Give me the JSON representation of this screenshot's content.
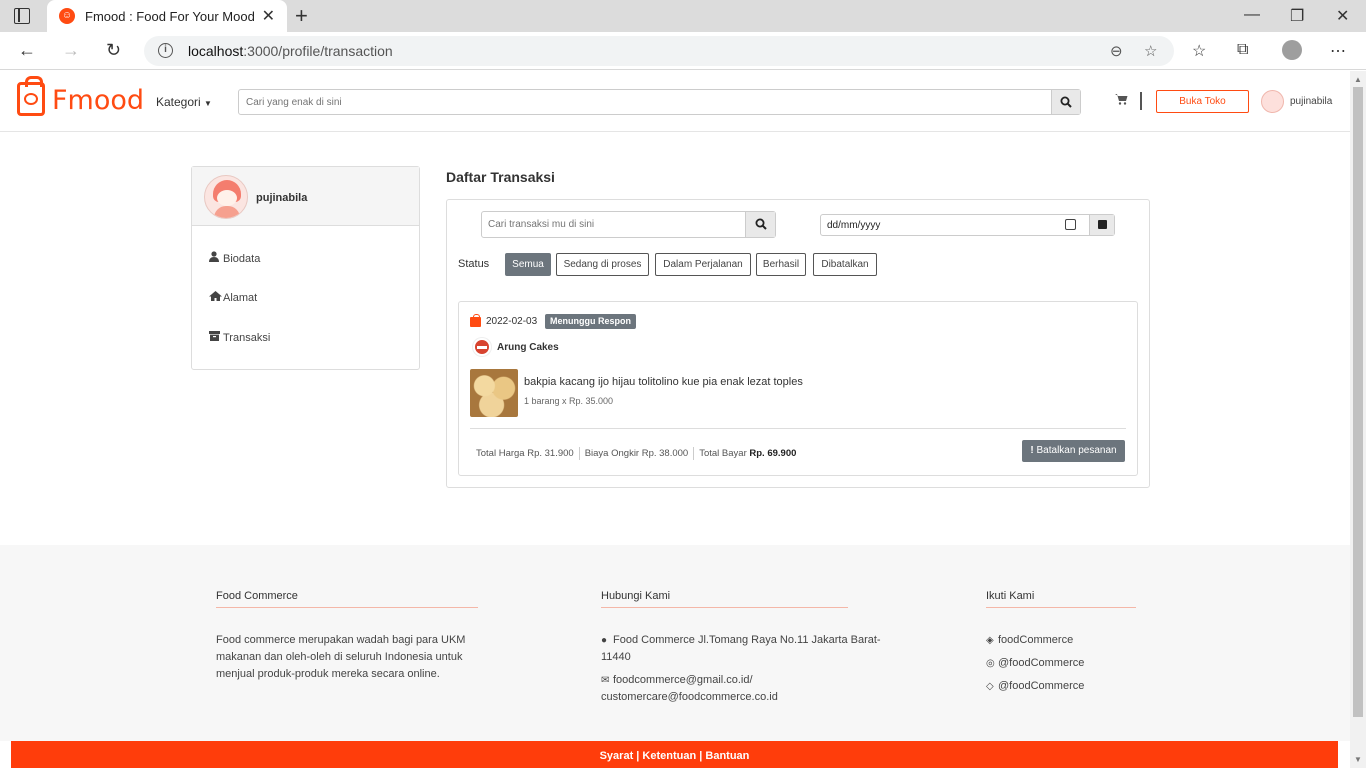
{
  "browser": {
    "tab_title": "Fmood : Food For Your Mood",
    "url_host": "localhost",
    "url_path": ":3000/profile/transaction"
  },
  "header": {
    "logo_text": "Fmood",
    "kategori_label": "Kategori",
    "search_placeholder": "Cari yang enak di sini",
    "buka_toko_label": "Buka Toko",
    "username": "pujinabila"
  },
  "sidebar": {
    "username": "pujinabila",
    "items": [
      {
        "label": "Biodata",
        "icon": "user-icon"
      },
      {
        "label": "Alamat",
        "icon": "home-icon"
      },
      {
        "label": "Transaksi",
        "icon": "archive-icon"
      }
    ]
  },
  "transactions": {
    "title": "Daftar Transaksi",
    "search_placeholder": "Cari transaksi mu di sini",
    "date_value": "dd/mm/yyyy",
    "status_label": "Status",
    "status_filters": [
      "Semua",
      "Sedang di proses",
      "Dalam Perjalanan",
      "Berhasil",
      "Dibatalkan"
    ],
    "active_filter": "Semua",
    "orders": [
      {
        "date": "2022-02-03",
        "badge": "Menunggu Respon",
        "shop": "Arung Cakes",
        "product_name": "bakpia kacang ijo hijau tolitolino kue pia enak lezat toples",
        "quantity_text": "1 barang x Rp. 35.000",
        "total_harga": "Total Harga Rp. 31.900",
        "biaya_ongkir": "Biaya Ongkir Rp. 38.000",
        "total_bayar_label": "Total Bayar",
        "total_bayar_value": "Rp. 69.900",
        "cancel_label": "Batalkan pesanan"
      }
    ]
  },
  "footer": {
    "about_title": "Food Commerce",
    "about_text": "Food commerce merupakan wadah bagi para UKM makanan dan oleh-oleh di seluruh Indonesia untuk menjual produk-produk mereka secara online.",
    "contact_title": "Hubungi Kami",
    "address": "Food Commerce Jl.Tomang Raya No.11 Jakarta Barat-11440",
    "email": "foodcommerce@gmail.co.id/ customercare@foodcommerce.co.id",
    "follow_title": "Ikuti Kami",
    "socials": [
      {
        "label": "foodCommerce",
        "icon": "facebook-icon"
      },
      {
        "label": "@foodCommerce",
        "icon": "instagram-icon"
      },
      {
        "label": "@foodCommerce",
        "icon": "twitter-icon"
      }
    ],
    "bottom_links": "Syarat | Ketentuan | Bantuan"
  },
  "colors": {
    "brand": "#ff4b12",
    "badge": "#6c757d",
    "bottom_bar": "#ff3d0b"
  }
}
